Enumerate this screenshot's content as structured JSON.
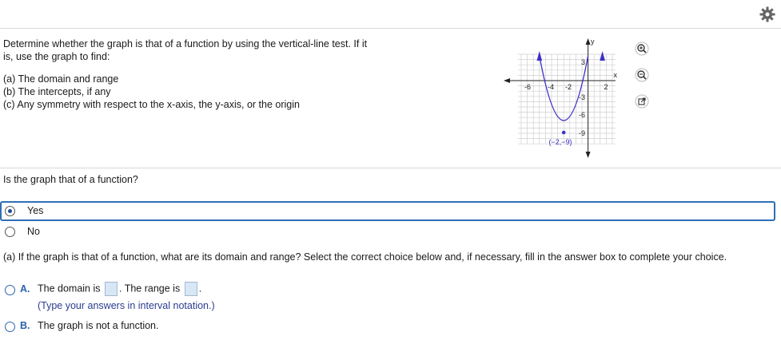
{
  "toolbar": {
    "settings_icon": "gear-icon"
  },
  "prompt": {
    "lines": [
      "Determine whether the graph is that of a function by using the vertical-line test. If it",
      "is, use the graph to find:",
      "(a)  The domain and range",
      "(b)  The intercepts, if any",
      "(c)  Any symmetry with respect to the x-axis, the y-axis, or the origin"
    ]
  },
  "graph": {
    "axis_x_label": "x",
    "axis_y_label": "y",
    "x_ticks": [
      "-6",
      "-4",
      "-2",
      "2"
    ],
    "y_ticks": [
      "3",
      "-3",
      "-6",
      "-9"
    ],
    "vertex_label": "(−2,−9)",
    "curve_color": "#3b2fc9",
    "tools": [
      "zoom-in-icon",
      "zoom-out-icon",
      "external-link-icon"
    ]
  },
  "question": {
    "text": "Is the graph that of a function?",
    "options": [
      {
        "label": "Yes",
        "selected": true
      },
      {
        "label": "No",
        "selected": false
      }
    ]
  },
  "part_a": {
    "text": "(a) If the graph is that of a function, what are its domain and range? Select the correct choice below and, if necessary, fill in the answer box to complete your choice.",
    "choice_a": {
      "letter": "A.",
      "pre": "The domain is",
      "mid": ". The range is",
      "post": ".",
      "hint": "(Type your answers in interval notation.)"
    },
    "choice_b": {
      "letter": "B.",
      "text": "The graph is not a function."
    }
  },
  "colors": {
    "accent": "#2a63ad",
    "selected_border": "#2f6fb5"
  }
}
